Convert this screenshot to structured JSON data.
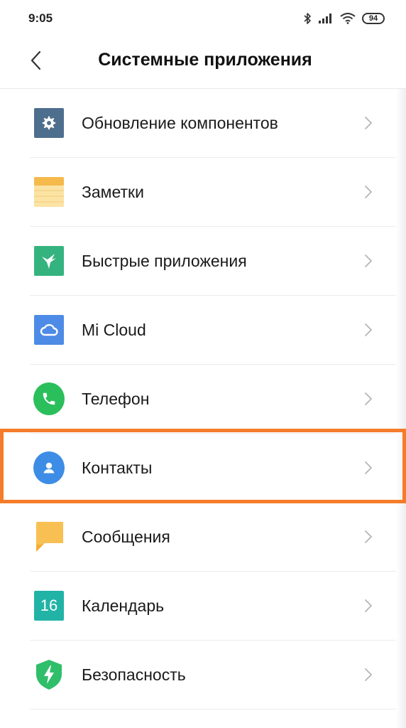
{
  "status_bar": {
    "time": "9:05",
    "battery": "94",
    "icons": [
      "bluetooth-icon",
      "signal-icon",
      "wifi-icon",
      "battery-icon"
    ]
  },
  "header": {
    "back_icon": "chevron-left-icon",
    "title": "Системные приложения"
  },
  "colors": {
    "highlight": "#f57c2a",
    "updates": "#4e6e8e",
    "notes": "#f9cf6d",
    "quick_apps": "#35b37e",
    "mi_cloud": "#4d8be6",
    "phone": "#2bbf5c",
    "contacts": "#3d8de6",
    "messages": "#f8c053",
    "calendar": "#21b3a6",
    "security": "#2fbe6a"
  },
  "items": [
    {
      "label": "Обновление компонентов",
      "icon": "gear-icon"
    },
    {
      "label": "Заметки",
      "icon": "notes-icon"
    },
    {
      "label": "Быстрые приложения",
      "icon": "hummingbird-icon"
    },
    {
      "label": "Mi Cloud",
      "icon": "cloud-icon"
    },
    {
      "label": "Телефон",
      "icon": "phone-icon"
    },
    {
      "label": "Контакты",
      "icon": "contact-icon",
      "highlighted": true
    },
    {
      "label": "Сообщения",
      "icon": "message-icon"
    },
    {
      "label": "Календарь",
      "icon": "calendar-icon",
      "icon_text": "16"
    },
    {
      "label": "Безопасность",
      "icon": "shield-icon"
    }
  ]
}
